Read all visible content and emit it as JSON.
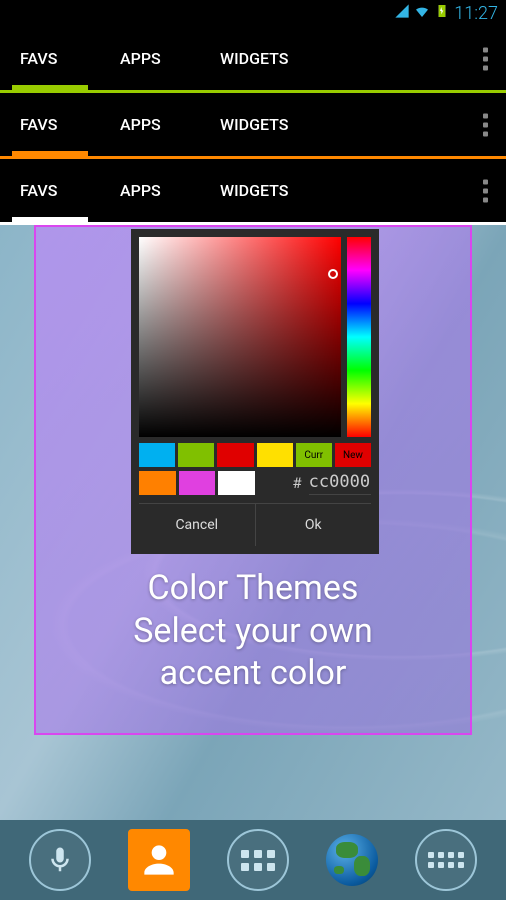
{
  "status": {
    "time": "11:27"
  },
  "tabs": {
    "favs": "FAVS",
    "apps": "APPS",
    "widgets": "WIDGETS"
  },
  "picker": {
    "swatches_row1": [
      "#00b0f0",
      "#80c000",
      "#e00000",
      "#ffe000"
    ],
    "curr_label": "Curr",
    "curr_color": "#80c000",
    "new_label": "New",
    "new_color": "#e00000",
    "swatches_row2": [
      "#ff8000",
      "#e040e0",
      "#ffffff"
    ],
    "hash": "#",
    "hex": "cc0000",
    "cancel": "Cancel",
    "ok": "Ok"
  },
  "marketing": {
    "line1": "Color Themes",
    "line2": "Select your own",
    "line3": "accent color"
  }
}
